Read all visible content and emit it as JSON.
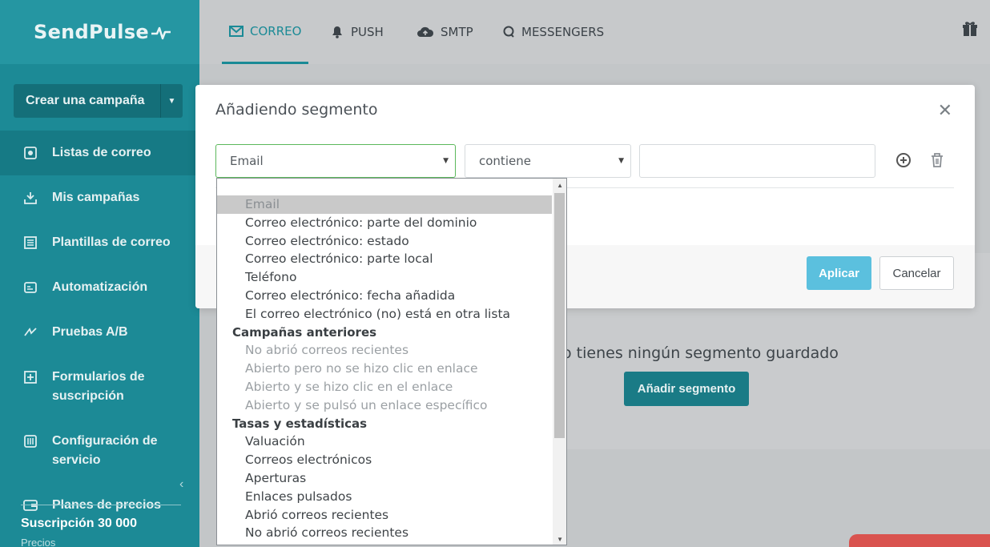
{
  "sidebar": {
    "logo": "SendPulse",
    "create_button": "Crear una campaña",
    "items": [
      {
        "label": "Listas de correo",
        "icon": "list-icon"
      },
      {
        "label": "Mis campañas",
        "icon": "campaign-icon"
      },
      {
        "label": "Plantillas de correo",
        "icon": "template-icon"
      },
      {
        "label": "Automatización",
        "icon": "automation-icon"
      },
      {
        "label": "Pruebas A/B",
        "icon": "ab-test-icon"
      },
      {
        "label": "Formularios de suscripción",
        "icon": "form-icon"
      },
      {
        "label": "Configuración de servicio",
        "icon": "settings-icon"
      },
      {
        "label": "Planes de precios",
        "icon": "wallet-icon"
      }
    ],
    "subscription": "Suscripción 30 000",
    "subscription_sub": "Precios"
  },
  "topnav": {
    "tabs": [
      {
        "label": "CORREO",
        "icon": "mail-icon"
      },
      {
        "label": "PUSH",
        "icon": "bell-icon"
      },
      {
        "label": "SMTP",
        "icon": "cloud-icon"
      },
      {
        "label": "MESSENGERS",
        "icon": "chat-icon"
      }
    ]
  },
  "page": {
    "empty_text": "o tienes ningún segmento guardado",
    "add_segment_button": "Añadir segmento"
  },
  "modal": {
    "title": "Añadiendo segmento",
    "field_select": "Email",
    "condition_select": "contiene",
    "value_input": "",
    "apply_button": "Aplicar",
    "cancel_button": "Cancelar"
  },
  "dropdown": {
    "options": [
      {
        "label": "Email",
        "type": "opt",
        "state": "hl"
      },
      {
        "label": "Correo electrónico: parte del dominio",
        "type": "opt"
      },
      {
        "label": "Correo electrónico: estado",
        "type": "opt"
      },
      {
        "label": "Correo electrónico: parte local",
        "type": "opt"
      },
      {
        "label": "Teléfono",
        "type": "opt"
      },
      {
        "label": "Correo electrónico: fecha añadida",
        "type": "opt"
      },
      {
        "label": "El correo electrónico (no) está en otra lista",
        "type": "opt"
      },
      {
        "label": "Campañas anteriores",
        "type": "grp"
      },
      {
        "label": "No abrió correos recientes",
        "type": "opt",
        "state": "disabled"
      },
      {
        "label": "Abierto pero no se hizo clic en enlace",
        "type": "opt",
        "state": "disabled"
      },
      {
        "label": "Abierto y se hizo clic en el enlace",
        "type": "opt",
        "state": "disabled"
      },
      {
        "label": "Abierto y se pulsó un enlace específico",
        "type": "opt",
        "state": "disabled"
      },
      {
        "label": "Tasas y estadísticas",
        "type": "grp"
      },
      {
        "label": "Valuación",
        "type": "opt"
      },
      {
        "label": "Correos electrónicos",
        "type": "opt"
      },
      {
        "label": "Aperturas",
        "type": "opt"
      },
      {
        "label": "Enlaces pulsados",
        "type": "opt"
      },
      {
        "label": "Abrió correos recientes",
        "type": "opt"
      },
      {
        "label": "No abrió correos recientes",
        "type": "opt"
      }
    ]
  },
  "colors": {
    "sidebar": "#1c8a96",
    "accent": "#1a8a96",
    "apply": "#5bc0de"
  }
}
